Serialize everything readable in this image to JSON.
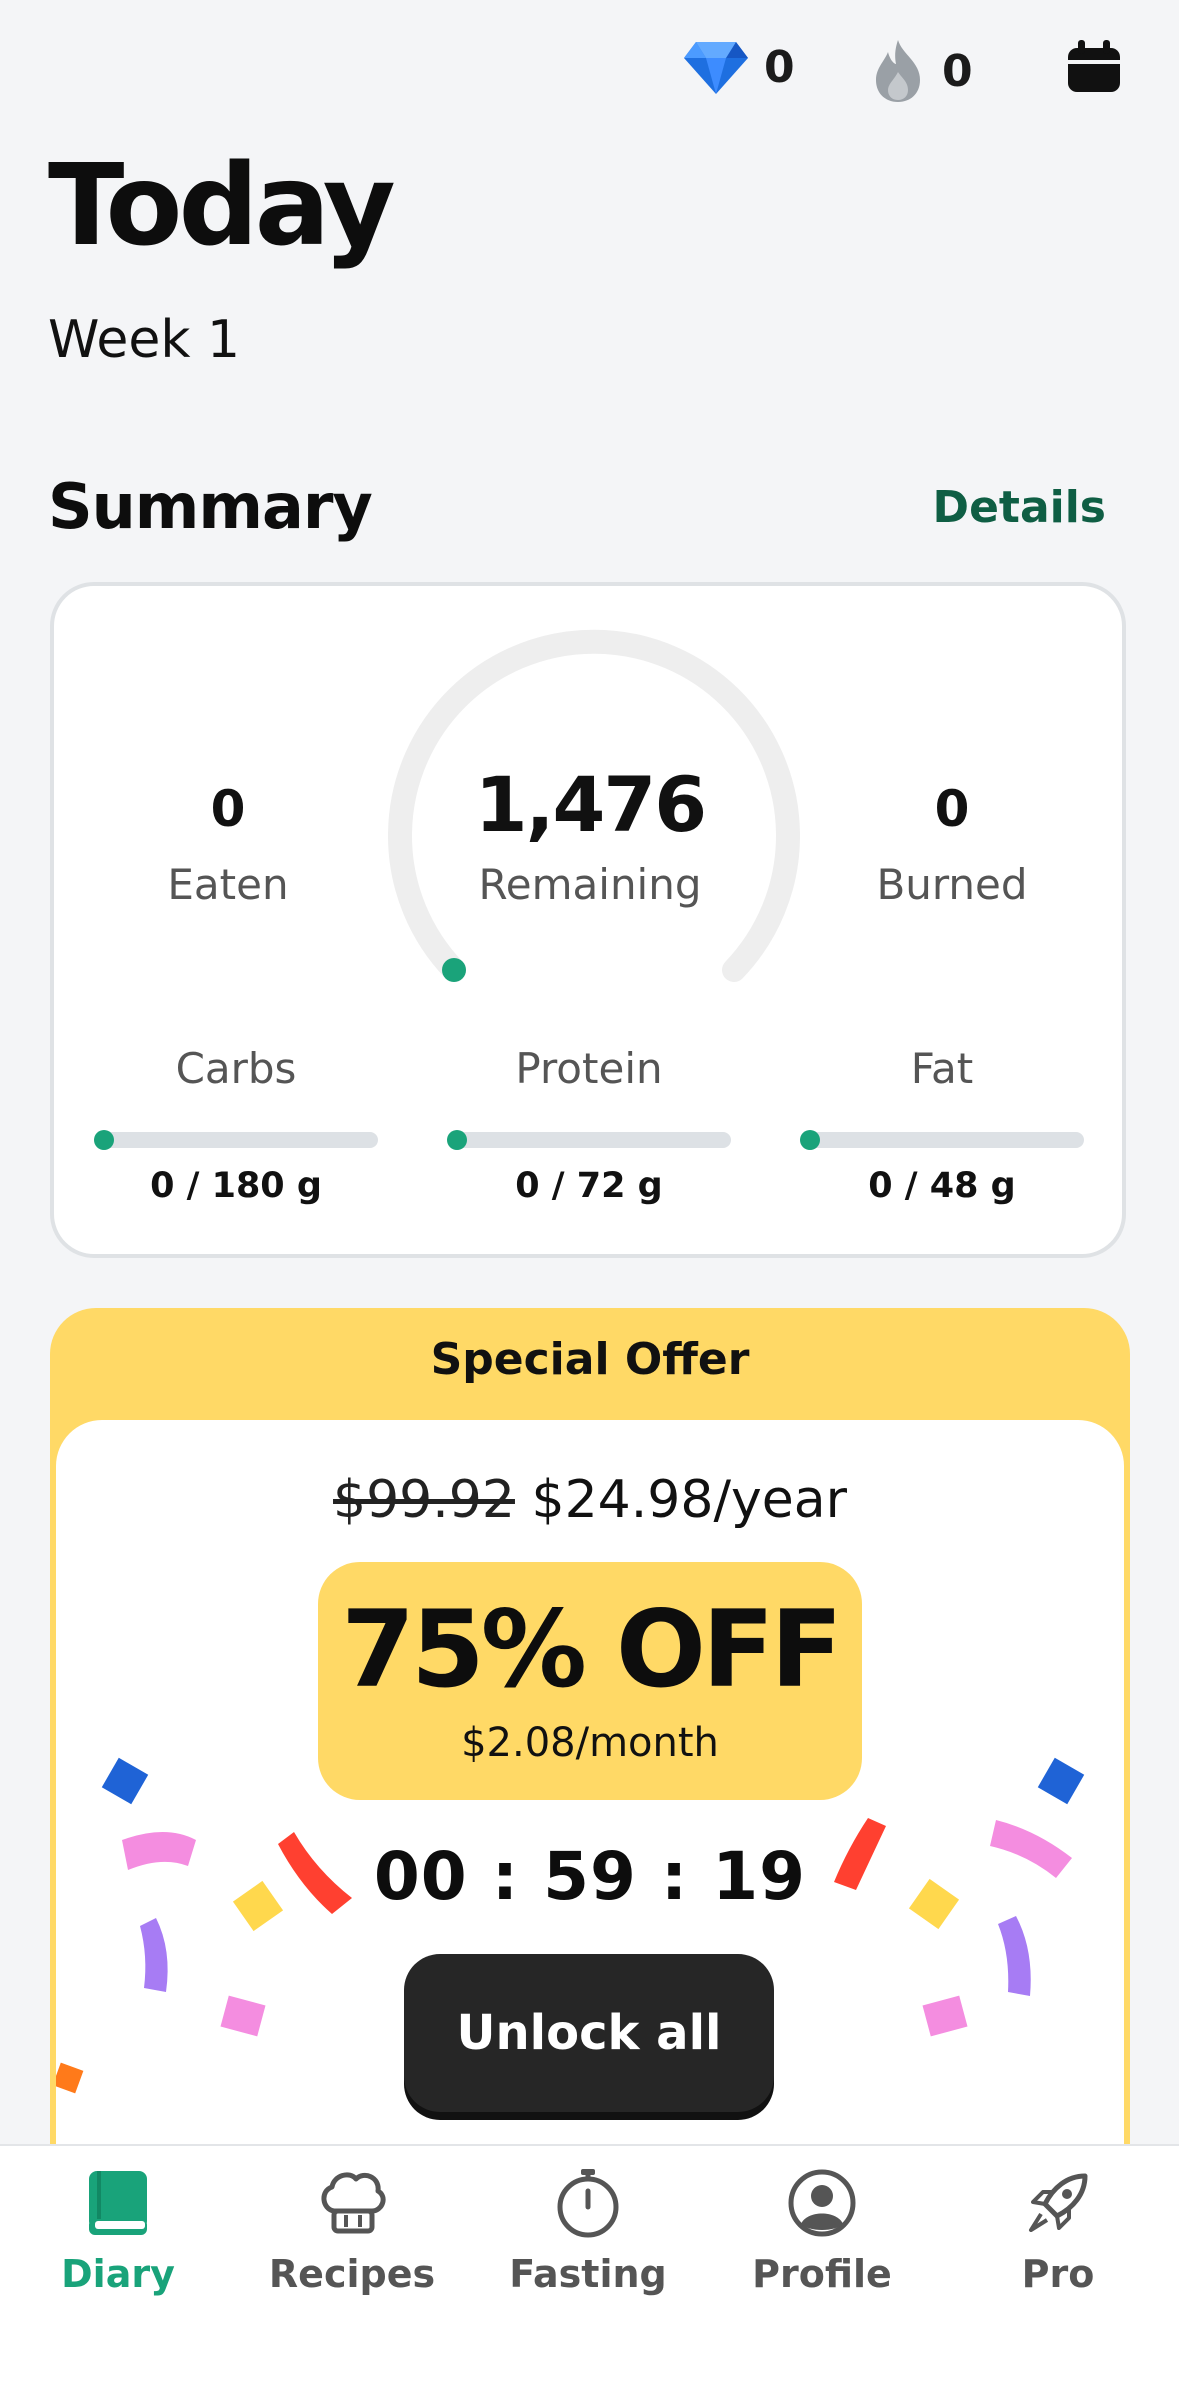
{
  "header": {
    "gems_count": "0",
    "streak_count": "0"
  },
  "page": {
    "title": "Today",
    "subtitle": "Week 1"
  },
  "summary": {
    "title": "Summary",
    "details_label": "Details",
    "eaten_value": "0",
    "eaten_label": "Eaten",
    "remaining_value": "1,476",
    "remaining_label": "Remaining",
    "burned_value": "0",
    "burned_label": "Burned",
    "macros": [
      {
        "label": "Carbs",
        "value": "0 / 180 g",
        "progress": 0
      },
      {
        "label": "Protein",
        "value": "0 / 72 g",
        "progress": 0
      },
      {
        "label": "Fat",
        "value": "0 / 48 g",
        "progress": 0
      }
    ],
    "calorie_progress": 0
  },
  "offer": {
    "title": "Special Offer",
    "old_price": "$99.92",
    "new_price": "$24.98/year",
    "discount": "75% OFF",
    "monthly": "$2.08/month",
    "timer": "00 : 59 : 19",
    "button_label": "Unlock all"
  },
  "tabs": [
    {
      "label": "Diary",
      "icon": "book-icon",
      "active": true
    },
    {
      "label": "Recipes",
      "icon": "chef-hat-icon",
      "active": false
    },
    {
      "label": "Fasting",
      "icon": "stopwatch-icon",
      "active": false
    },
    {
      "label": "Profile",
      "icon": "user-circle-icon",
      "active": false
    },
    {
      "label": "Pro",
      "icon": "rocket-icon",
      "active": false
    }
  ],
  "colors": {
    "accent_green": "#19a37a",
    "details_green": "#0f5e44",
    "offer_yellow": "#ffd966",
    "gem_blue": "#1e6fe0"
  }
}
